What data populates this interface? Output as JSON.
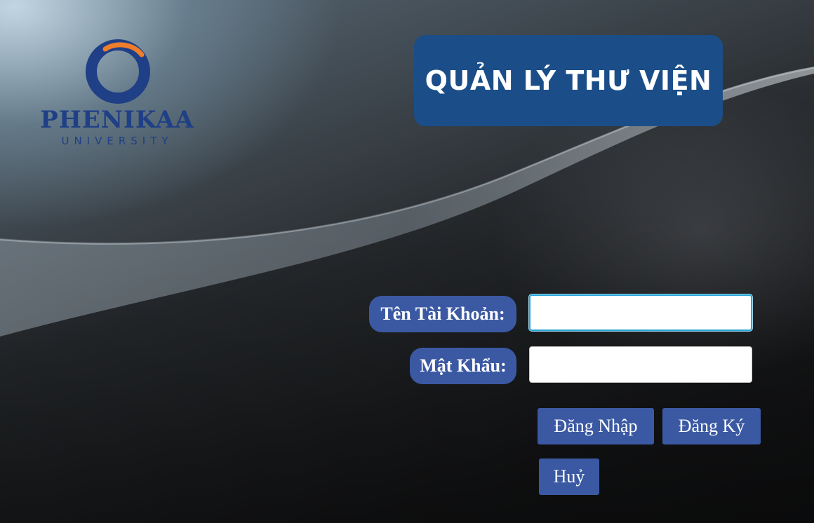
{
  "brand": {
    "name": "PHENIKAA",
    "subtitle": "UNIVERSITY",
    "logo_icon": "phenikaa-ring-logo",
    "colors": {
      "navy": "#1f3f86",
      "orange": "#ef7d2c"
    }
  },
  "header": {
    "title": "QUẢN LÝ THƯ VIỆN"
  },
  "form": {
    "username_label": "Tên Tài Khoản:",
    "username_value": "",
    "password_label": "Mật Khẩu:",
    "password_value": ""
  },
  "buttons": {
    "login": "Đăng Nhập",
    "register": "Đăng Ký",
    "cancel": "Huỷ"
  },
  "colors": {
    "title_bg": "#1b4e88",
    "accent": "#3b59a3",
    "focus": "#28a6d8"
  }
}
